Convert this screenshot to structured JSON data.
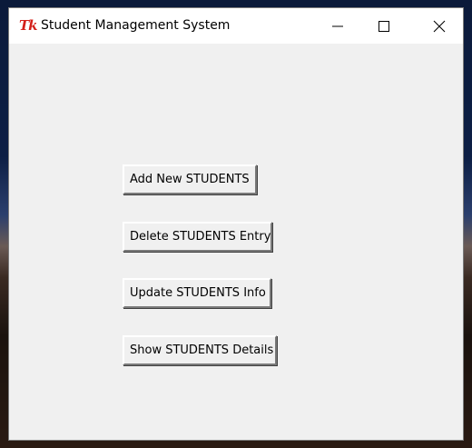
{
  "window": {
    "title": "Student Management System",
    "icon": "tk-icon",
    "controls": {
      "minimize": "minimize-icon",
      "maximize": "maximize-icon",
      "close": "close-icon"
    }
  },
  "buttons": {
    "add": "Add New STUDENTS",
    "delete": "Delete STUDENTS Entry",
    "update": "Update STUDENTS Info",
    "show": "Show STUDENTS Details"
  },
  "colors": {
    "window_bg": "#f0f0f0",
    "titlebar_bg": "#ffffff",
    "tk_icon": "#d4201a"
  }
}
